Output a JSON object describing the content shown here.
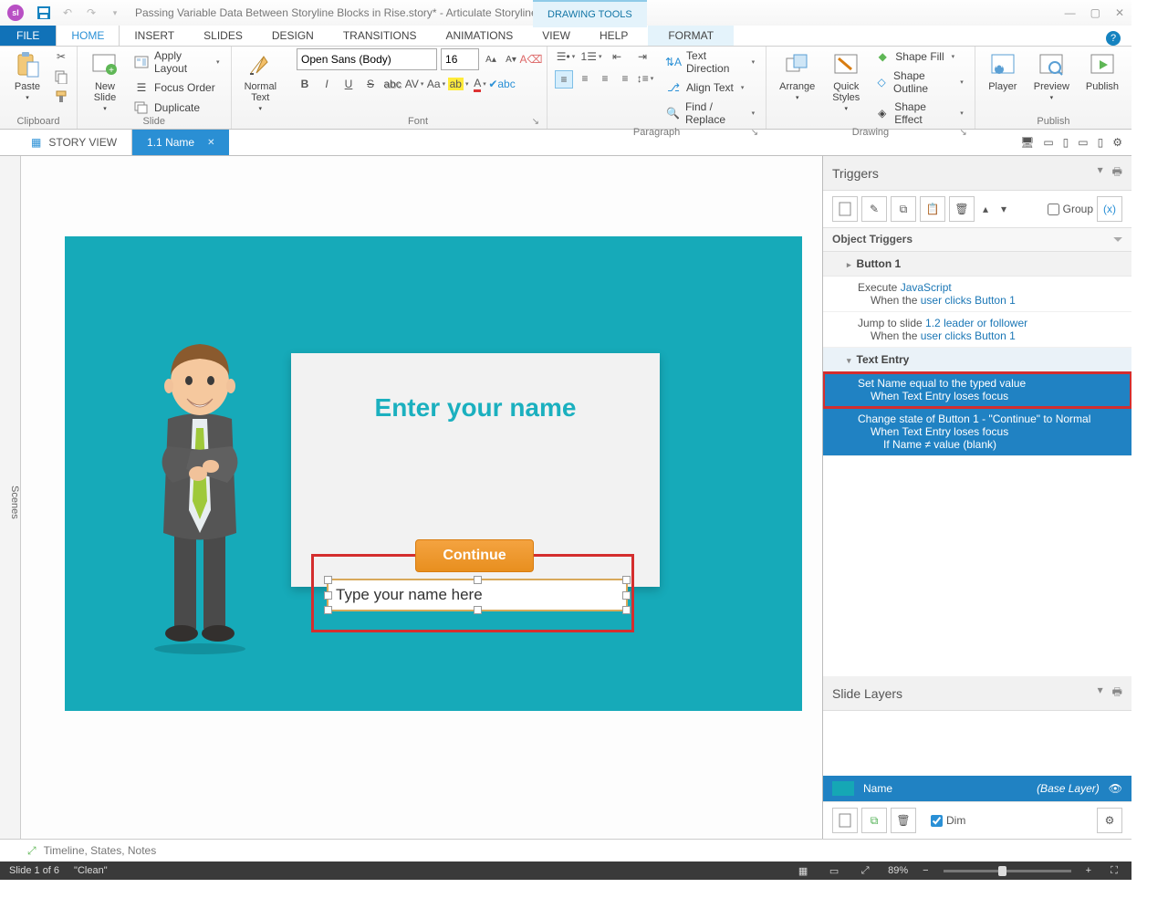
{
  "titlebar": {
    "sl": "sl",
    "doc_title": "Passing Variable Data Between Storyline Blocks in Rise.story* - Articulate Storyline",
    "contextual": "DRAWING TOOLS"
  },
  "ribbon_tabs": {
    "file": "FILE",
    "home": "HOME",
    "insert": "INSERT",
    "slides": "SLIDES",
    "design": "DESIGN",
    "transitions": "TRANSITIONS",
    "animations": "ANIMATIONS",
    "view": "VIEW",
    "help": "HELP",
    "format": "FORMAT"
  },
  "ribbon": {
    "clipboard": {
      "paste": "Paste",
      "group": "Clipboard"
    },
    "slide": {
      "new_slide": "New\nSlide",
      "apply_layout": "Apply Layout",
      "focus_order": "Focus Order",
      "duplicate": "Duplicate",
      "group": "Slide"
    },
    "text": {
      "normal_text": "Normal\nText"
    },
    "font": {
      "family": "Open Sans (Body)",
      "size": "16",
      "group": "Font"
    },
    "paragraph": {
      "text_direction": "Text Direction",
      "align_text": "Align Text",
      "find_replace": "Find / Replace",
      "group": "Paragraph"
    },
    "drawing": {
      "arrange": "Arrange",
      "quick_styles": "Quick\nStyles",
      "shape_fill": "Shape Fill",
      "shape_outline": "Shape Outline",
      "shape_effect": "Shape Effect",
      "group": "Drawing"
    },
    "publish": {
      "player": "Player",
      "preview": "Preview",
      "publish": "Publish",
      "group": "Publish"
    }
  },
  "doc_tabs": {
    "story_view": "STORY VIEW",
    "slide_tab": "1.1 Name"
  },
  "scenes_label": "Scenes",
  "slide": {
    "card_title": "Enter your name",
    "placeholder": "Type your name here",
    "continue": "Continue"
  },
  "triggers": {
    "title": "Triggers",
    "group_label": "Group",
    "section": "Object Triggers",
    "button1": "Button 1",
    "execute": "Execute",
    "javascript": "JavaScript",
    "when_user_clicks_a": "When the",
    "user_clicks": "user clicks",
    "button1_link": "Button 1",
    "jump_to": "Jump to slide",
    "jump_target": "1.2 leader or follower",
    "text_entry": "Text Entry",
    "set_name": "Set Name equal to the typed value",
    "when_loses_focus": "When Text Entry loses focus",
    "change_state_a": "Change state of",
    "change_state_b": "Button 1 - \"Continue\"",
    "change_state_c": "to",
    "change_state_d": "Normal",
    "when_te": "When",
    "te_loses": "Text Entry loses focus",
    "if_name": "If Name ≠",
    "value": "value",
    "blank": "(blank)"
  },
  "slide_layers": {
    "title": "Slide Layers",
    "name": "Name",
    "base": "(Base Layer)",
    "dim": "Dim"
  },
  "timeline_strip": "Timeline, States, Notes",
  "status": {
    "left": "Slide 1 of 6",
    "theme": "\"Clean\"",
    "zoom": "89%"
  }
}
